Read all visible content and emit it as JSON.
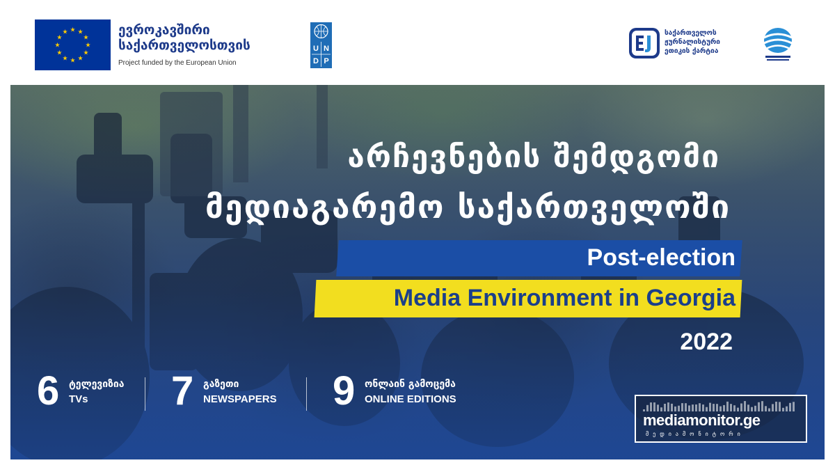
{
  "header": {
    "eu": {
      "line1": "ევროკავშირი",
      "line2": "საქართველოსთვის",
      "subtitle": "Project funded by the European Union",
      "flag_color": "#003399",
      "star_color": "#ffcc00"
    },
    "undp": {
      "letters": [
        "U",
        "N",
        "D",
        "P"
      ],
      "color": "#1f6db6"
    },
    "cej": {
      "line1": "საქართველოს",
      "line2": "ჟურნალისტური",
      "line3": "ეთიკის ქარტია",
      "color": "#1d3a8a"
    },
    "globe_icon": "globe-icon"
  },
  "banner": {
    "title_line1": "არჩევნების შემდგომი",
    "title_line2": "მედიაგარემო საქართველოში",
    "english_line1": "Post-election",
    "english_line2": "Media Environment in Georgia",
    "year": "2022",
    "accent_blue": "#1b4ea6",
    "accent_yellow": "#f2de1f"
  },
  "stats": [
    {
      "number": "6",
      "label_ka": "ტელევიზია",
      "label_en": "TVs"
    },
    {
      "number": "7",
      "label_ka": "გაზეთი",
      "label_en": "NEWSPAPERS"
    },
    {
      "number": "9",
      "label_ka": "ონლაინ გამოცემა",
      "label_en": "ONLINE EDITIONS"
    }
  ],
  "mediamonitor": {
    "name": "mediamonitor.ge",
    "tagline": "მედიამონიტორი"
  }
}
